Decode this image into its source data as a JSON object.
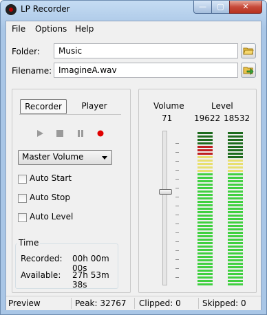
{
  "window": {
    "title": "LP Recorder",
    "controls": {
      "minimize": "—",
      "maximize": "▢",
      "close": "✕"
    }
  },
  "menu": {
    "items": [
      "File",
      "Options",
      "Help"
    ]
  },
  "folder": {
    "label": "Folder:",
    "value": "Music",
    "icon": "open-folder-icon"
  },
  "filename": {
    "label": "Filename:",
    "value": "ImagineA.wav",
    "icon": "folder-green-arrow-icon"
  },
  "tabs": [
    {
      "label": "Recorder",
      "active": true
    },
    {
      "label": "Player",
      "active": false
    }
  ],
  "transport": {
    "icons": [
      "play-icon",
      "stop-icon",
      "pause-icon",
      "record-icon"
    ],
    "record_color": "#e00000"
  },
  "source": {
    "selected": "Master Volume"
  },
  "options": [
    {
      "label": "Auto Start",
      "checked": false
    },
    {
      "label": "Auto Stop",
      "checked": false
    },
    {
      "label": "Auto Level",
      "checked": false
    }
  ],
  "time": {
    "title": "Time",
    "recorded_label": "Recorded:",
    "recorded_value": "00h 00m 00s",
    "available_label": "Available:",
    "available_value": "27h 53m 38s"
  },
  "volume": {
    "header": "Volume",
    "value": "71"
  },
  "level": {
    "header": "Level",
    "left": "19622",
    "right": "18532"
  },
  "status": {
    "mode": "Preview",
    "peak": "Peak: 32767",
    "clipped": "Clipped: 0",
    "skipped": "Skipped: 0"
  },
  "colors": {
    "meter_dark_green": "#1d6b1d",
    "meter_red": "#c02020",
    "meter_yellow": "#e8e070",
    "meter_green": "#40d040"
  }
}
